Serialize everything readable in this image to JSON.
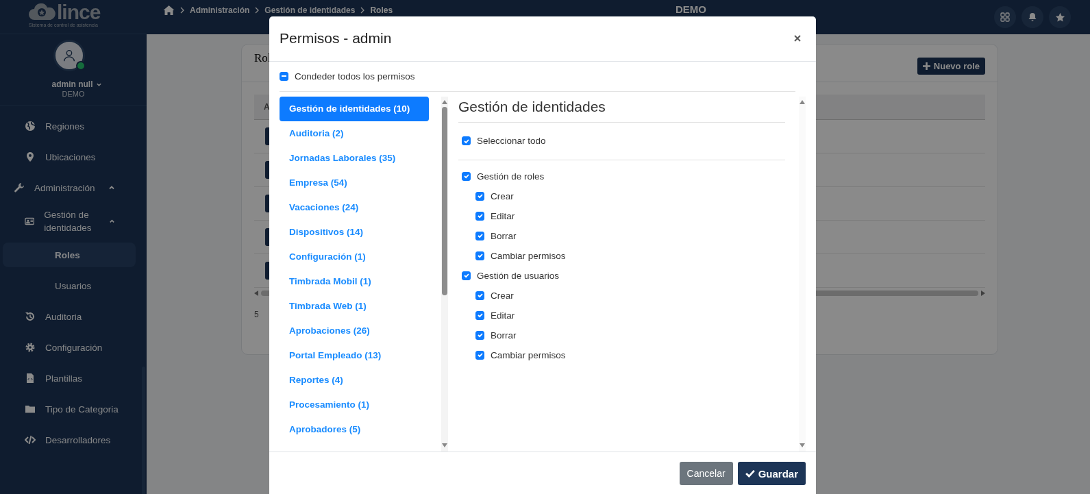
{
  "header": {
    "logo": "lince",
    "logo_subtitle": "Sistema de control de asistencia",
    "breadcrumb": [
      "Administración",
      "Gestión de identidades",
      "Roles"
    ],
    "center_label": "DEMO"
  },
  "user": {
    "name": "admin null",
    "org": "DEMO",
    "online": true
  },
  "sidebar": {
    "items": [
      {
        "label": "Regiones",
        "selected": false
      },
      {
        "label": "Ubicaciones",
        "selected": false
      },
      {
        "label": "Administración",
        "expanded": true,
        "selected": false,
        "children": [
          {
            "label": "Gestión de identidades",
            "expanded": true,
            "selected": false,
            "children": [
              {
                "label": "Roles",
                "selected": true
              },
              {
                "label": "Usuarios",
                "selected": false
              }
            ]
          }
        ]
      },
      {
        "label": "Auditoria",
        "selected": false
      },
      {
        "label": "Configuración",
        "selected": false
      },
      {
        "label": "Plantillas",
        "selected": false
      },
      {
        "label": "Tipo de Categoria",
        "selected": false
      },
      {
        "label": "Desarrolladores",
        "selected": false
      }
    ]
  },
  "page": {
    "card_title": "Rol",
    "new_button": "Nuevo role",
    "column_1": "A",
    "footer_text": "5"
  },
  "modal": {
    "title": "Permisos - admin",
    "grant_all": {
      "label": "Condeder todos los permisos",
      "indeterminate": true
    },
    "categories": [
      {
        "label": "Gestión de identidades (10)",
        "selected": true
      },
      {
        "label": "Auditoria (2)",
        "selected": false
      },
      {
        "label": "Jornadas Laborales (35)",
        "selected": false
      },
      {
        "label": "Empresa (54)",
        "selected": false
      },
      {
        "label": "Vacaciones (24)",
        "selected": false
      },
      {
        "label": "Dispositivos (14)",
        "selected": false
      },
      {
        "label": "Configuración (1)",
        "selected": false
      },
      {
        "label": "Timbrada Mobil (1)",
        "selected": false
      },
      {
        "label": "Timbrada Web (1)",
        "selected": false
      },
      {
        "label": "Aprobaciones (26)",
        "selected": false
      },
      {
        "label": "Portal Empleado (13)",
        "selected": false
      },
      {
        "label": "Reportes (4)",
        "selected": false
      },
      {
        "label": "Procesamiento (1)",
        "selected": false
      },
      {
        "label": "Aprobadores (5)",
        "selected": false
      }
    ],
    "section": {
      "title": "Gestión de identidades",
      "select_all": {
        "label": "Seleccionar todo",
        "checked": true
      },
      "groups": [
        {
          "label": "Gestión de roles",
          "checked": true,
          "children": [
            {
              "label": "Crear",
              "checked": true
            },
            {
              "label": "Editar",
              "checked": true
            },
            {
              "label": "Borrar",
              "checked": true
            },
            {
              "label": "Cambiar permisos",
              "checked": true
            }
          ]
        },
        {
          "label": "Gestión de usuarios",
          "checked": true,
          "children": [
            {
              "label": "Crear",
              "checked": true
            },
            {
              "label": "Editar",
              "checked": true
            },
            {
              "label": "Borrar",
              "checked": true
            },
            {
              "label": "Cambiar permisos",
              "checked": true
            }
          ]
        }
      ]
    },
    "buttons": {
      "cancel": "Cancelar",
      "save": "Guardar"
    }
  }
}
